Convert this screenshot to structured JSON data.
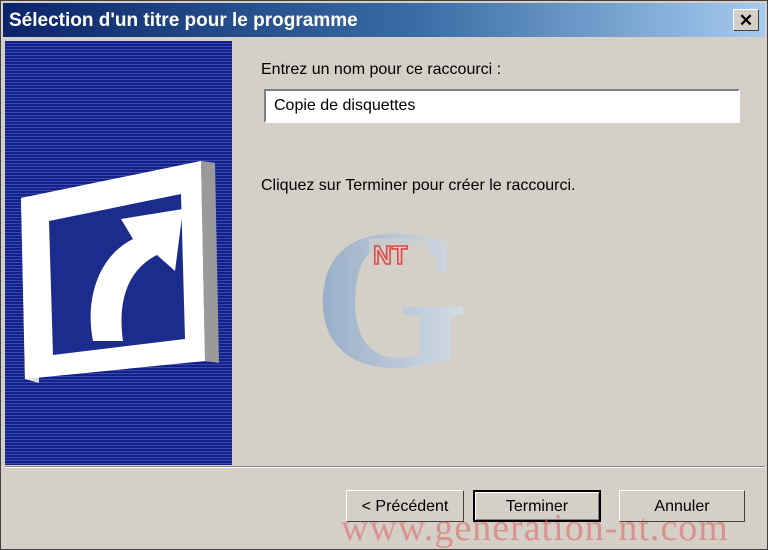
{
  "window": {
    "title": "Sélection d'un titre pour le programme",
    "close_symbol": "✕"
  },
  "banner": {
    "icon": "shortcut-arrow-icon"
  },
  "form": {
    "name_label": "Entrez un nom pour ce raccourci :",
    "name_value": "Copie de disquettes",
    "instruction": "Cliquez sur Terminer pour créer le raccourci."
  },
  "buttons": {
    "previous": "< Précédent",
    "finish": "Terminer",
    "cancel": "Annuler"
  },
  "watermark": {
    "logo_letter": "G",
    "logo_badge": "NT",
    "url": "www.generation-nt.com"
  },
  "colors": {
    "title_bar_start": "#0a246a",
    "title_bar_end": "#a6caf0",
    "banner_blue": "#1c2c8c",
    "dialog_face": "#d4d0c8"
  }
}
